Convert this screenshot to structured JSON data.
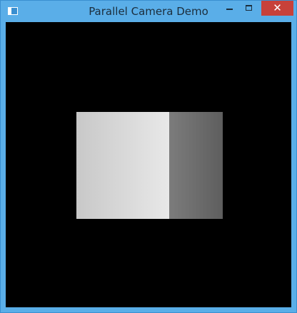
{
  "window": {
    "title": "Parallel Camera Demo",
    "icons": {
      "app": "window-app-icon",
      "minimize": "minimize-icon",
      "maximize": "maximize-icon",
      "close": "close-icon"
    },
    "close_glyph": "✕"
  },
  "scene": {
    "background": "#000000",
    "cube_front_colors": [
      "#c8c8c8",
      "#e8e8e8"
    ],
    "cube_side_colors": [
      "#7c7c7c",
      "#5e5e5e"
    ]
  }
}
